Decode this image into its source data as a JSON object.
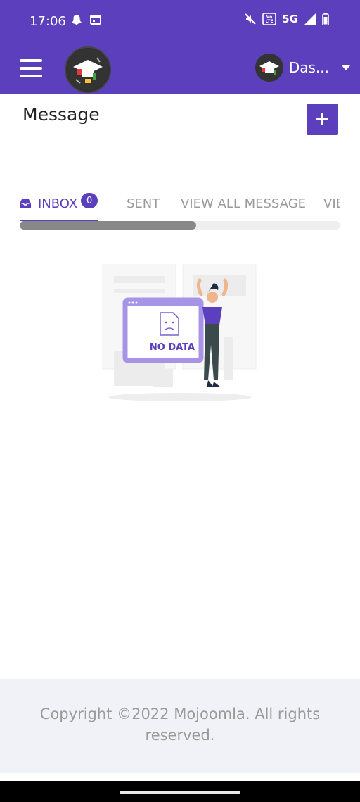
{
  "status_bar": {
    "time": "17:06",
    "network": "5G",
    "volte": "Vo LTE",
    "icons": [
      "snapchat-icon",
      "calendar-icon",
      "mute-icon",
      "volte-icon",
      "signal-icon",
      "battery-icon"
    ]
  },
  "app_bar": {
    "user_name": "Das...",
    "icons": [
      "menu-icon",
      "school-logo",
      "avatar",
      "caret-down-icon"
    ]
  },
  "page": {
    "title": "Message",
    "add_icon": "plus-icon"
  },
  "tabs": [
    {
      "label": "INBOX",
      "badge": "0",
      "icon": "inbox-icon",
      "active": true
    },
    {
      "label": "SENT"
    },
    {
      "label": "VIEW ALL MESSAGE"
    },
    {
      "label": "VIE"
    }
  ],
  "tab_scroll": {
    "visible_fraction": 0.55
  },
  "empty_state": {
    "label": "NO DATA",
    "icon": "sad-file-icon"
  },
  "footer": {
    "copyright": "Copyright ©2022 Mojoomla. All rights reserved."
  },
  "colors": {
    "primary": "#5b3fbd",
    "muted": "#9a9a9a",
    "footer_bg": "#f0f2f7"
  }
}
